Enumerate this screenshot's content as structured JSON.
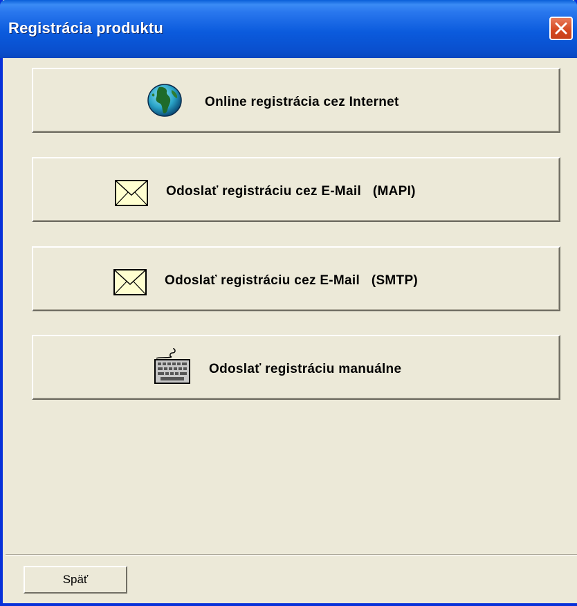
{
  "window": {
    "title": "Registrácia produktu"
  },
  "buttons": [
    {
      "label": "Online registrácia cez Internet",
      "icon": "globe-icon"
    },
    {
      "label": "Odoslať registráciu cez E-Mail   (MAPI)",
      "icon": "envelope-icon"
    },
    {
      "label": "Odoslať registráciu cez E-Mail   (SMTP)",
      "icon": "envelope-icon"
    },
    {
      "label": "Odoslať registráciu manuálne",
      "icon": "keyboard-icon"
    }
  ],
  "footer": {
    "back_label": "Späť"
  },
  "colors": {
    "titlebar": "#0A5FD8",
    "background": "#ECE9D8",
    "close": "#D4471E"
  }
}
